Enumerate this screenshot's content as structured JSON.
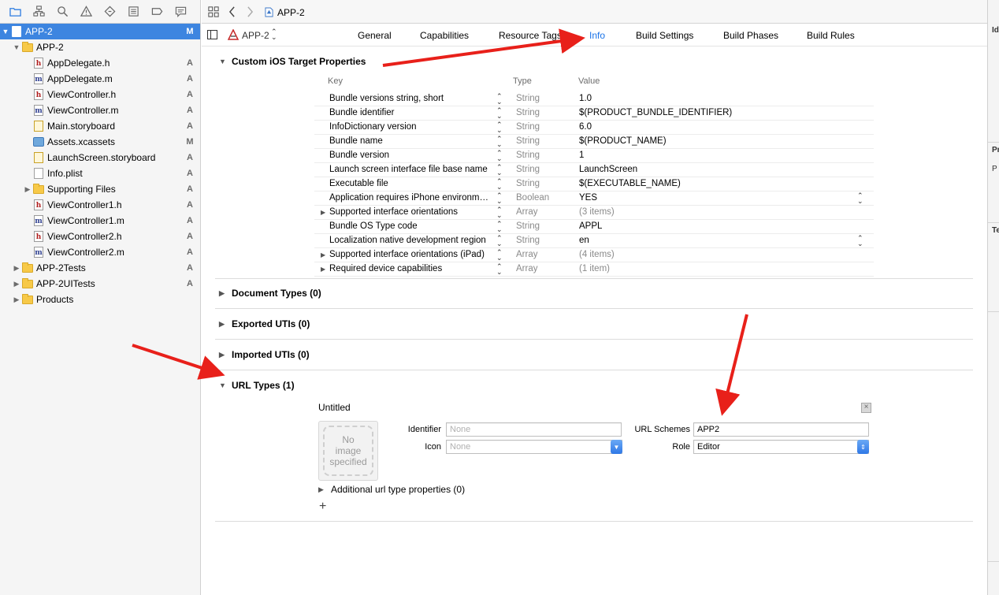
{
  "navigator": {
    "toolbar_icons": [
      "folder-icon",
      "hierarchy-icon",
      "search-icon",
      "warning-icon",
      "test-icon",
      "debug-icon",
      "breakpoint-icon",
      "report-icon"
    ],
    "items": [
      {
        "label": "APP-2",
        "status": "M",
        "kind": "project",
        "disclosure": "▼",
        "selected": true
      },
      {
        "label": "APP-2",
        "status": "",
        "kind": "folder",
        "disclosure": "▼"
      },
      {
        "label": "AppDelegate.h",
        "status": "A",
        "kind": "h"
      },
      {
        "label": "AppDelegate.m",
        "status": "A",
        "kind": "m"
      },
      {
        "label": "ViewController.h",
        "status": "A",
        "kind": "h"
      },
      {
        "label": "ViewController.m",
        "status": "A",
        "kind": "m"
      },
      {
        "label": "Main.storyboard",
        "status": "A",
        "kind": "storyboard"
      },
      {
        "label": "Assets.xcassets",
        "status": "M",
        "kind": "xcassets"
      },
      {
        "label": "LaunchScreen.storyboard",
        "status": "A",
        "kind": "storyboard"
      },
      {
        "label": "Info.plist",
        "status": "A",
        "kind": "plist"
      },
      {
        "label": "Supporting Files",
        "status": "A",
        "kind": "folder",
        "disclosure": "▶"
      },
      {
        "label": "ViewController1.h",
        "status": "A",
        "kind": "h"
      },
      {
        "label": "ViewController1.m",
        "status": "A",
        "kind": "m"
      },
      {
        "label": "ViewController2.h",
        "status": "A",
        "kind": "h"
      },
      {
        "label": "ViewController2.m",
        "status": "A",
        "kind": "m"
      },
      {
        "label": "APP-2Tests",
        "status": "A",
        "kind": "folder",
        "disclosure": "▶"
      },
      {
        "label": "APP-2UITests",
        "status": "A",
        "kind": "folder",
        "disclosure": "▶"
      },
      {
        "label": "Products",
        "status": "",
        "kind": "folder",
        "disclosure": "▶"
      }
    ]
  },
  "jumpbar": {
    "file": "APP-2"
  },
  "target": {
    "name": "APP-2"
  },
  "tabs": [
    {
      "label": "General",
      "active": false
    },
    {
      "label": "Capabilities",
      "active": false
    },
    {
      "label": "Resource Tags",
      "active": false
    },
    {
      "label": "Info",
      "active": true
    },
    {
      "label": "Build Settings",
      "active": false
    },
    {
      "label": "Build Phases",
      "active": false
    },
    {
      "label": "Build Rules",
      "active": false
    }
  ],
  "custom_properties": {
    "title": "Custom iOS Target Properties",
    "headers": {
      "key": "Key",
      "type": "Type",
      "value": "Value"
    },
    "rows": [
      {
        "key": "Bundle versions string, short",
        "type": "String",
        "value": "1.0",
        "expandable": false,
        "dim": false,
        "popup": false
      },
      {
        "key": "Bundle identifier",
        "type": "String",
        "value": "$(PRODUCT_BUNDLE_IDENTIFIER)",
        "expandable": false,
        "dim": false,
        "popup": false
      },
      {
        "key": "InfoDictionary version",
        "type": "String",
        "value": "6.0",
        "expandable": false,
        "dim": false,
        "popup": false
      },
      {
        "key": "Bundle name",
        "type": "String",
        "value": "$(PRODUCT_NAME)",
        "expandable": false,
        "dim": false,
        "popup": false
      },
      {
        "key": "Bundle version",
        "type": "String",
        "value": "1",
        "expandable": false,
        "dim": false,
        "popup": false
      },
      {
        "key": "Launch screen interface file base name",
        "type": "String",
        "value": "LaunchScreen",
        "expandable": false,
        "dim": false,
        "popup": false
      },
      {
        "key": "Executable file",
        "type": "String",
        "value": "$(EXECUTABLE_NAME)",
        "expandable": false,
        "dim": false,
        "popup": false
      },
      {
        "key": "Application requires iPhone environm…",
        "type": "Boolean",
        "value": "YES",
        "expandable": false,
        "dim": false,
        "popup": true
      },
      {
        "key": "Supported interface orientations",
        "type": "Array",
        "value": "(3 items)",
        "expandable": true,
        "dim": true,
        "popup": false
      },
      {
        "key": "Bundle OS Type code",
        "type": "String",
        "value": "APPL",
        "expandable": false,
        "dim": false,
        "popup": false
      },
      {
        "key": "Localization native development region",
        "type": "String",
        "value": "en",
        "expandable": false,
        "dim": false,
        "popup": true
      },
      {
        "key": "Supported interface orientations (iPad)",
        "type": "Array",
        "value": "(4 items)",
        "expandable": true,
        "dim": true,
        "popup": false
      },
      {
        "key": "Required device capabilities",
        "type": "Array",
        "value": "(1 item)",
        "expandable": true,
        "dim": true,
        "popup": false
      }
    ]
  },
  "sections": {
    "document_types": "Document Types (0)",
    "exported_utis": "Exported UTIs (0)",
    "imported_utis": "Imported UTIs (0)",
    "url_types": "URL Types (1)"
  },
  "url_type": {
    "name": "Untitled",
    "image_placeholder": "No image specified",
    "identifier_label": "Identifier",
    "identifier_placeholder": "None",
    "icon_label": "Icon",
    "icon_placeholder": "None",
    "url_schemes_label": "URL Schemes",
    "url_schemes_value": "APP2",
    "role_label": "Role",
    "role_value": "Editor",
    "additional": "Additional url type properties (0)",
    "add_symbol": "+"
  },
  "inspector": {
    "labels": [
      "Id",
      "Pr",
      "P",
      "Te"
    ]
  },
  "colors": {
    "selection": "#3d85e0",
    "accent": "#1a73e8",
    "arrow": "#e8201a"
  }
}
